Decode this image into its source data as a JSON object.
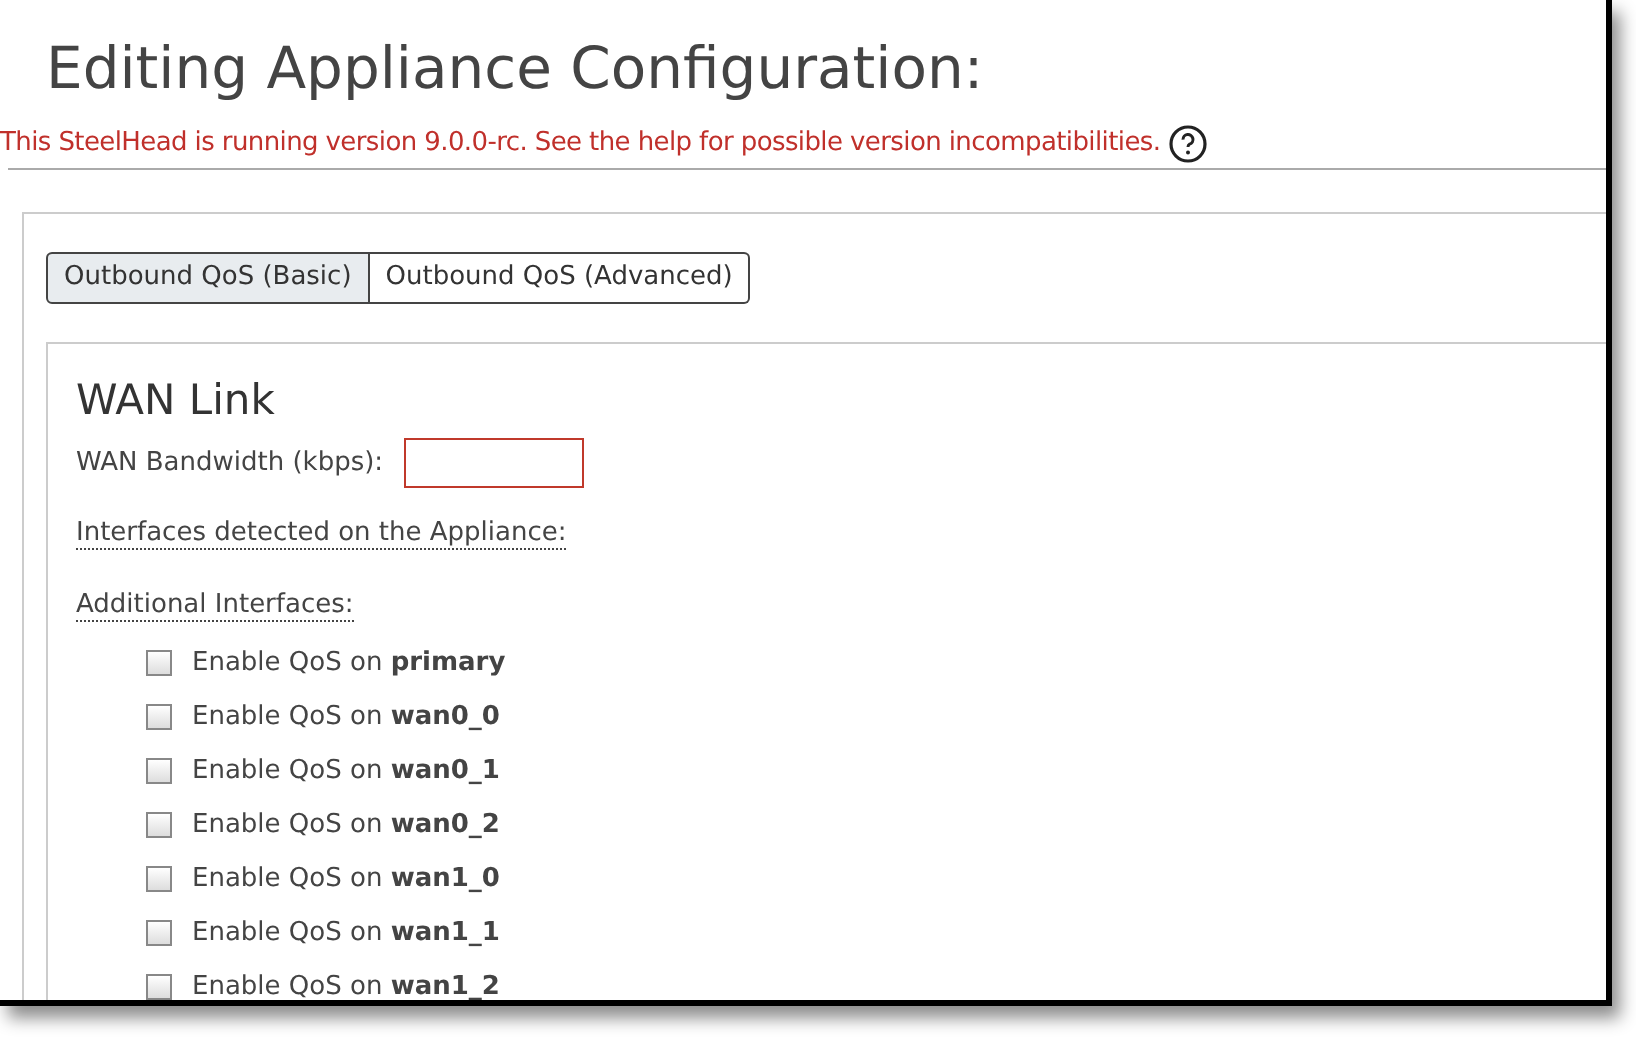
{
  "page": {
    "title": "Editing Appliance Configuration:",
    "warning": "This SteelHead is running version 9.0.0-rc. See the help for possible version incompatibilities."
  },
  "tabs": [
    {
      "label": "Outbound QoS (Basic)",
      "selected": true
    },
    {
      "label": "Outbound QoS (Advanced)",
      "selected": false
    }
  ],
  "section": {
    "title": "WAN Link",
    "bandwidth_label": "WAN Bandwidth (kbps):",
    "detected_label": "Interfaces detected on the Appliance:",
    "additional_label": "Additional Interfaces:"
  },
  "interfaces": [
    {
      "label": "Enable QoS on **primary**",
      "checked": false
    },
    {
      "label": "Enable QoS on **wan0_0**",
      "checked": false
    },
    {
      "label": "Enable QoS on **wan0_1**",
      "checked": false
    },
    {
      "label": "Enable QoS on **wan0_2**",
      "checked": false
    },
    {
      "label": "Enable QoS on **wan1_0**",
      "checked": false
    },
    {
      "label": "Enable QoS on **wan1_1**",
      "checked": false
    },
    {
      "label": "Enable QoS on **wan1_2**",
      "checked": false
    }
  ]
}
